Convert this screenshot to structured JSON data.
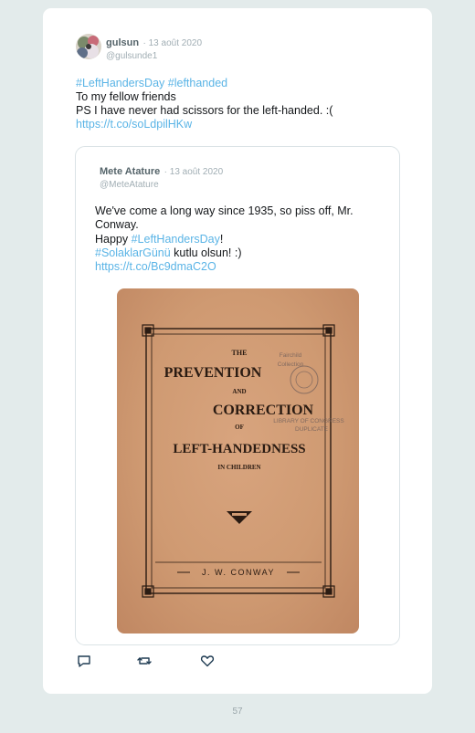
{
  "tweet": {
    "author_name": "gulsun",
    "date": "· 13 août 2020",
    "handle": "@gulsunde1",
    "text": {
      "hashtag1": "#LeftHandersDay",
      "hashtag2": "#lefthanded",
      "line2": "To my fellow friends",
      "line3": "PS I have never had scissors for the left-handed. :(",
      "link": "https://t.co/soLdpilHKw"
    }
  },
  "quoted": {
    "author_name": "Mete Atature",
    "date": "· 13 août 2020",
    "handle": "@MeteAtature",
    "text": {
      "line1": "We've come a long way since 1935, so piss off, Mr.",
      "line2": "Conway.",
      "happy": "Happy ",
      "hashtag1": "#LeftHandersDay",
      "excl": "!",
      "hashtag2": "#SolaklarGünü",
      "rest": " kutlu olsun! :)",
      "link": "https://t.co/Bc9dmaC2O"
    },
    "image": {
      "title_the": "THE",
      "title_prevention": "PREVENTION",
      "title_and": "AND",
      "title_correction": "CORRECTION",
      "title_of": "OF",
      "title_lefthandedness": "LEFT-HANDEDNESS",
      "title_inchildren": "IN CHILDREN",
      "author": "J. W. CONWAY",
      "stamp_line1": "Fairchild",
      "stamp_line2": "Collection",
      "stamp_line3": "LIBRARY OF CONGRESS",
      "stamp_line4": "DUPLICATE"
    }
  },
  "actions": {
    "reply": "reply-icon",
    "retweet": "retweet-icon",
    "like": "heart-icon"
  },
  "page_number": "57",
  "colors": {
    "background": "#e3ebeb",
    "link": "#5ab4e6",
    "book_cover": "#cf9a72",
    "book_ink": "#2a1b12"
  }
}
